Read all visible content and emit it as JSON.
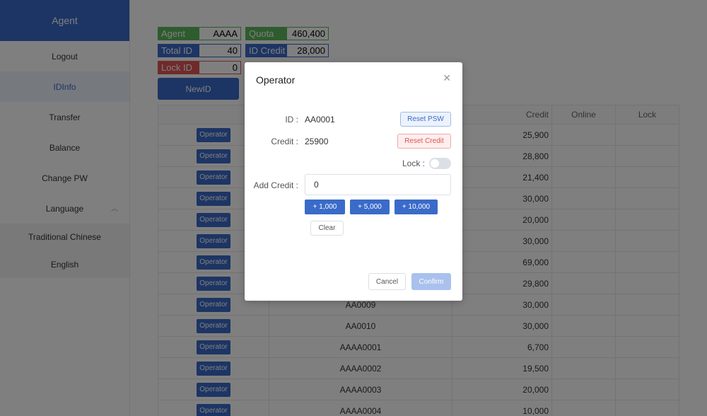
{
  "sidebar": {
    "header": "Agent",
    "items": [
      {
        "label": "Logout"
      },
      {
        "label": "IDInfo"
      },
      {
        "label": "Transfer"
      },
      {
        "label": "Balance"
      },
      {
        "label": "Change PW"
      },
      {
        "label": "Language"
      }
    ],
    "language_options": [
      "Traditional Chinese",
      "English"
    ]
  },
  "stats": {
    "agent_label": "Agent",
    "agent_value": "AAAA",
    "quota_label": "Quota",
    "quota_value": "460,400",
    "total_id_label": "Total ID",
    "total_id_value": "40",
    "id_credit_label": "ID Credit",
    "id_credit_value": "28,000",
    "lock_id_label": "Lock ID",
    "lock_id_value": "0"
  },
  "new_id_label": "NewID",
  "table": {
    "headers": {
      "credit": "Credit",
      "online": "Online",
      "lock": "Lock"
    },
    "operator_label": "Operator",
    "rows": [
      {
        "id": "",
        "credit": "25,900"
      },
      {
        "id": "",
        "credit": "28,800"
      },
      {
        "id": "",
        "credit": "21,400"
      },
      {
        "id": "",
        "credit": "30,000"
      },
      {
        "id": "",
        "credit": "20,000"
      },
      {
        "id": "",
        "credit": "30,000"
      },
      {
        "id": "",
        "credit": "69,000"
      },
      {
        "id": "",
        "credit": "29,800"
      },
      {
        "id": "AA0009",
        "credit": "30,000"
      },
      {
        "id": "AA0010",
        "credit": "30,000"
      },
      {
        "id": "AAAA0001",
        "credit": "6,700"
      },
      {
        "id": "AAAA0002",
        "credit": "19,500"
      },
      {
        "id": "AAAA0003",
        "credit": "20,000"
      },
      {
        "id": "AAAA0004",
        "credit": "10,000"
      }
    ]
  },
  "modal": {
    "title": "Operator",
    "id_label": "ID :",
    "id_value": "AA0001",
    "reset_psw": "Reset PSW",
    "credit_label": "Credit :",
    "credit_value": "25900",
    "reset_credit": "Reset Credit",
    "lock_label": "Lock :",
    "add_credit_label": "Add Credit :",
    "add_credit_value": "0",
    "plus_buttons": [
      "+ 1,000",
      "+ 5,000",
      "+ 10,000"
    ],
    "clear_label": "Clear",
    "cancel_label": "Cancel",
    "confirm_label": "Confirm"
  }
}
